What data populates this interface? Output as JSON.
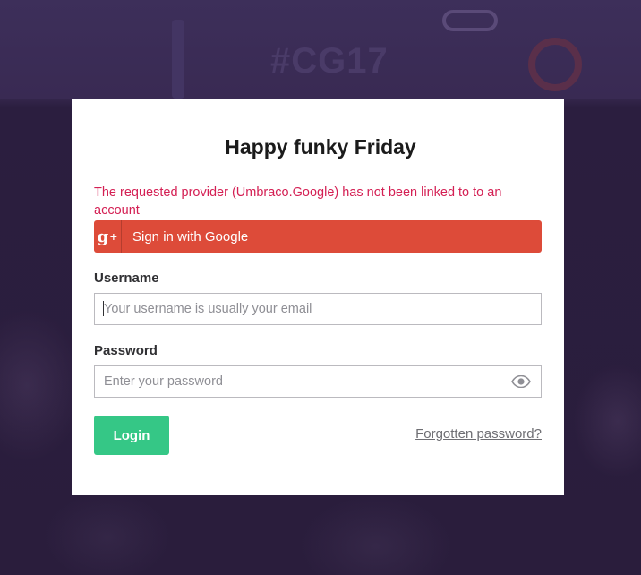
{
  "background": {
    "hashtag": "#CG17"
  },
  "login": {
    "greeting": "Happy funky Friday",
    "error_message": "The requested provider (Umbraco.Google) has not been linked to to an account",
    "google_button": {
      "icon": "google-plus-icon",
      "icon_text": "g+",
      "label": "Sign in with Google",
      "color": "#dd4b39"
    },
    "username": {
      "label": "Username",
      "placeholder": "Your username is usually your email",
      "value": ""
    },
    "password": {
      "label": "Password",
      "placeholder": "Enter your password",
      "value": "",
      "toggle_icon": "eye-icon"
    },
    "login_button": {
      "label": "Login",
      "color": "#35c786"
    },
    "forgot_link": "Forgotten password?"
  },
  "colors": {
    "error": "#d42054",
    "background": "#2a1d3c"
  }
}
